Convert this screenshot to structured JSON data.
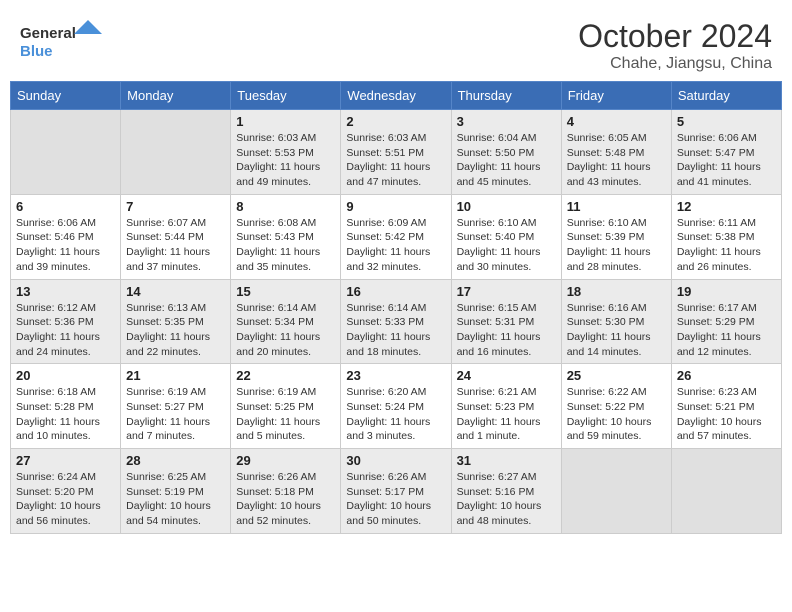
{
  "header": {
    "logo_line1": "General",
    "logo_line2": "Blue",
    "month": "October 2024",
    "location": "Chahe, Jiangsu, China"
  },
  "weekdays": [
    "Sunday",
    "Monday",
    "Tuesday",
    "Wednesday",
    "Thursday",
    "Friday",
    "Saturday"
  ],
  "weeks": [
    [
      {
        "day": "",
        "sunrise": "",
        "sunset": "",
        "daylight": ""
      },
      {
        "day": "",
        "sunrise": "",
        "sunset": "",
        "daylight": ""
      },
      {
        "day": "1",
        "sunrise": "Sunrise: 6:03 AM",
        "sunset": "Sunset: 5:53 PM",
        "daylight": "Daylight: 11 hours and 49 minutes."
      },
      {
        "day": "2",
        "sunrise": "Sunrise: 6:03 AM",
        "sunset": "Sunset: 5:51 PM",
        "daylight": "Daylight: 11 hours and 47 minutes."
      },
      {
        "day": "3",
        "sunrise": "Sunrise: 6:04 AM",
        "sunset": "Sunset: 5:50 PM",
        "daylight": "Daylight: 11 hours and 45 minutes."
      },
      {
        "day": "4",
        "sunrise": "Sunrise: 6:05 AM",
        "sunset": "Sunset: 5:48 PM",
        "daylight": "Daylight: 11 hours and 43 minutes."
      },
      {
        "day": "5",
        "sunrise": "Sunrise: 6:06 AM",
        "sunset": "Sunset: 5:47 PM",
        "daylight": "Daylight: 11 hours and 41 minutes."
      }
    ],
    [
      {
        "day": "6",
        "sunrise": "Sunrise: 6:06 AM",
        "sunset": "Sunset: 5:46 PM",
        "daylight": "Daylight: 11 hours and 39 minutes."
      },
      {
        "day": "7",
        "sunrise": "Sunrise: 6:07 AM",
        "sunset": "Sunset: 5:44 PM",
        "daylight": "Daylight: 11 hours and 37 minutes."
      },
      {
        "day": "8",
        "sunrise": "Sunrise: 6:08 AM",
        "sunset": "Sunset: 5:43 PM",
        "daylight": "Daylight: 11 hours and 35 minutes."
      },
      {
        "day": "9",
        "sunrise": "Sunrise: 6:09 AM",
        "sunset": "Sunset: 5:42 PM",
        "daylight": "Daylight: 11 hours and 32 minutes."
      },
      {
        "day": "10",
        "sunrise": "Sunrise: 6:10 AM",
        "sunset": "Sunset: 5:40 PM",
        "daylight": "Daylight: 11 hours and 30 minutes."
      },
      {
        "day": "11",
        "sunrise": "Sunrise: 6:10 AM",
        "sunset": "Sunset: 5:39 PM",
        "daylight": "Daylight: 11 hours and 28 minutes."
      },
      {
        "day": "12",
        "sunrise": "Sunrise: 6:11 AM",
        "sunset": "Sunset: 5:38 PM",
        "daylight": "Daylight: 11 hours and 26 minutes."
      }
    ],
    [
      {
        "day": "13",
        "sunrise": "Sunrise: 6:12 AM",
        "sunset": "Sunset: 5:36 PM",
        "daylight": "Daylight: 11 hours and 24 minutes."
      },
      {
        "day": "14",
        "sunrise": "Sunrise: 6:13 AM",
        "sunset": "Sunset: 5:35 PM",
        "daylight": "Daylight: 11 hours and 22 minutes."
      },
      {
        "day": "15",
        "sunrise": "Sunrise: 6:14 AM",
        "sunset": "Sunset: 5:34 PM",
        "daylight": "Daylight: 11 hours and 20 minutes."
      },
      {
        "day": "16",
        "sunrise": "Sunrise: 6:14 AM",
        "sunset": "Sunset: 5:33 PM",
        "daylight": "Daylight: 11 hours and 18 minutes."
      },
      {
        "day": "17",
        "sunrise": "Sunrise: 6:15 AM",
        "sunset": "Sunset: 5:31 PM",
        "daylight": "Daylight: 11 hours and 16 minutes."
      },
      {
        "day": "18",
        "sunrise": "Sunrise: 6:16 AM",
        "sunset": "Sunset: 5:30 PM",
        "daylight": "Daylight: 11 hours and 14 minutes."
      },
      {
        "day": "19",
        "sunrise": "Sunrise: 6:17 AM",
        "sunset": "Sunset: 5:29 PM",
        "daylight": "Daylight: 11 hours and 12 minutes."
      }
    ],
    [
      {
        "day": "20",
        "sunrise": "Sunrise: 6:18 AM",
        "sunset": "Sunset: 5:28 PM",
        "daylight": "Daylight: 11 hours and 10 minutes."
      },
      {
        "day": "21",
        "sunrise": "Sunrise: 6:19 AM",
        "sunset": "Sunset: 5:27 PM",
        "daylight": "Daylight: 11 hours and 7 minutes."
      },
      {
        "day": "22",
        "sunrise": "Sunrise: 6:19 AM",
        "sunset": "Sunset: 5:25 PM",
        "daylight": "Daylight: 11 hours and 5 minutes."
      },
      {
        "day": "23",
        "sunrise": "Sunrise: 6:20 AM",
        "sunset": "Sunset: 5:24 PM",
        "daylight": "Daylight: 11 hours and 3 minutes."
      },
      {
        "day": "24",
        "sunrise": "Sunrise: 6:21 AM",
        "sunset": "Sunset: 5:23 PM",
        "daylight": "Daylight: 11 hours and 1 minute."
      },
      {
        "day": "25",
        "sunrise": "Sunrise: 6:22 AM",
        "sunset": "Sunset: 5:22 PM",
        "daylight": "Daylight: 10 hours and 59 minutes."
      },
      {
        "day": "26",
        "sunrise": "Sunrise: 6:23 AM",
        "sunset": "Sunset: 5:21 PM",
        "daylight": "Daylight: 10 hours and 57 minutes."
      }
    ],
    [
      {
        "day": "27",
        "sunrise": "Sunrise: 6:24 AM",
        "sunset": "Sunset: 5:20 PM",
        "daylight": "Daylight: 10 hours and 56 minutes."
      },
      {
        "day": "28",
        "sunrise": "Sunrise: 6:25 AM",
        "sunset": "Sunset: 5:19 PM",
        "daylight": "Daylight: 10 hours and 54 minutes."
      },
      {
        "day": "29",
        "sunrise": "Sunrise: 6:26 AM",
        "sunset": "Sunset: 5:18 PM",
        "daylight": "Daylight: 10 hours and 52 minutes."
      },
      {
        "day": "30",
        "sunrise": "Sunrise: 6:26 AM",
        "sunset": "Sunset: 5:17 PM",
        "daylight": "Daylight: 10 hours and 50 minutes."
      },
      {
        "day": "31",
        "sunrise": "Sunrise: 6:27 AM",
        "sunset": "Sunset: 5:16 PM",
        "daylight": "Daylight: 10 hours and 48 minutes."
      },
      {
        "day": "",
        "sunrise": "",
        "sunset": "",
        "daylight": ""
      },
      {
        "day": "",
        "sunrise": "",
        "sunset": "",
        "daylight": ""
      }
    ]
  ]
}
